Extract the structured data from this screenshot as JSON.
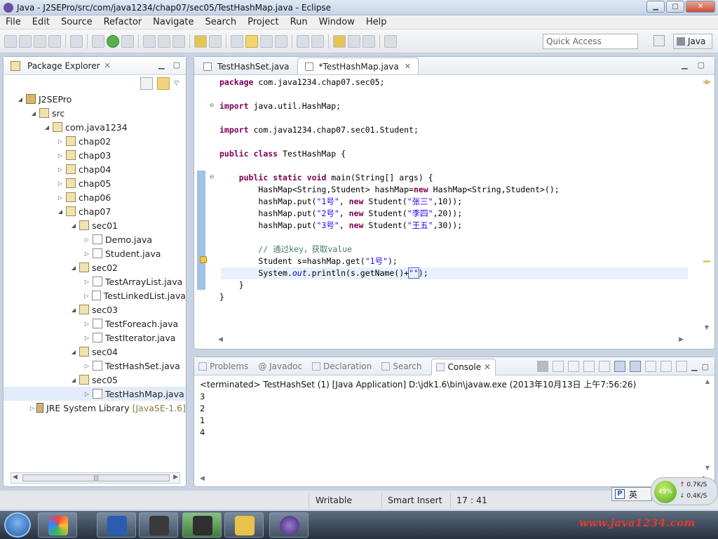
{
  "window": {
    "title": "Java - J2SEPro/src/com/java1234/chap07/sec05/TestHashMap.java - Eclipse",
    "min": "▁",
    "max": "▢",
    "close": "✕"
  },
  "menu": [
    "File",
    "Edit",
    "Source",
    "Refactor",
    "Navigate",
    "Search",
    "Project",
    "Run",
    "Window",
    "Help"
  ],
  "toolbar": {
    "quick_access_placeholder": "Quick Access",
    "perspective": "Java"
  },
  "package_explorer": {
    "title": "Package Explorer",
    "tree": [
      {
        "label": "J2SEPro",
        "indent": 0,
        "icon": "project",
        "twisty": "◢"
      },
      {
        "label": "src",
        "indent": 1,
        "icon": "package",
        "twisty": "◢"
      },
      {
        "label": "com.java1234",
        "indent": 2,
        "icon": "package",
        "twisty": "◢"
      },
      {
        "label": "chap02",
        "indent": 3,
        "icon": "package",
        "twisty": "▷"
      },
      {
        "label": "chap03",
        "indent": 3,
        "icon": "package",
        "twisty": "▷"
      },
      {
        "label": "chap04",
        "indent": 3,
        "icon": "package",
        "twisty": "▷"
      },
      {
        "label": "chap05",
        "indent": 3,
        "icon": "package",
        "twisty": "▷"
      },
      {
        "label": "chap06",
        "indent": 3,
        "icon": "package",
        "twisty": "▷"
      },
      {
        "label": "chap07",
        "indent": 3,
        "icon": "package",
        "twisty": "◢"
      },
      {
        "label": "sec01",
        "indent": 4,
        "icon": "package",
        "twisty": "◢"
      },
      {
        "label": "Demo.java",
        "indent": 5,
        "icon": "java",
        "twisty": "▷"
      },
      {
        "label": "Student.java",
        "indent": 5,
        "icon": "java",
        "twisty": "▷"
      },
      {
        "label": "sec02",
        "indent": 4,
        "icon": "package",
        "twisty": "◢"
      },
      {
        "label": "TestArrayList.java",
        "indent": 5,
        "icon": "java",
        "twisty": "▷"
      },
      {
        "label": "TestLinkedList.java",
        "indent": 5,
        "icon": "java",
        "twisty": "▷"
      },
      {
        "label": "sec03",
        "indent": 4,
        "icon": "package",
        "twisty": "◢"
      },
      {
        "label": "TestForeach.java",
        "indent": 5,
        "icon": "java",
        "twisty": "▷"
      },
      {
        "label": "TestIterator.java",
        "indent": 5,
        "icon": "java",
        "twisty": "▷"
      },
      {
        "label": "sec04",
        "indent": 4,
        "icon": "package",
        "twisty": "◢"
      },
      {
        "label": "TestHashSet.java",
        "indent": 5,
        "icon": "java",
        "twisty": "▷"
      },
      {
        "label": "sec05",
        "indent": 4,
        "icon": "package",
        "twisty": "◢"
      },
      {
        "label": "TestHashMap.java",
        "indent": 5,
        "icon": "java",
        "twisty": "▷",
        "selected": true
      },
      {
        "label": "JRE System Library",
        "extra": "[JavaSE-1.6]",
        "indent": 1,
        "icon": "jre",
        "twisty": "▷"
      }
    ]
  },
  "editor": {
    "tabs": [
      {
        "label": "TestHashSet.java",
        "active": false
      },
      {
        "label": "*TestHashMap.java",
        "active": true
      }
    ],
    "code": {
      "l1": "com.java1234.chap07.sec05;",
      "l2": "java.util.HashMap;",
      "l3": "com.java1234.chap07.sec01.Student;",
      "l4": "TestHashMap {",
      "l5a": "main(String[] args) {",
      "l6": "HashMap<String,Student> hashMap=",
      "l6b": "HashMap<String,Student>();",
      "put1k": "\"1号\"",
      "put1v": "\"张三\"",
      "put1n": ",10));",
      "put2k": "\"2号\"",
      "put2v": "\"李四\"",
      "put2n": ",20));",
      "put3k": "\"3号\"",
      "put3v": "\"王五\"",
      "put3n": ",30));",
      "comment": "// 通过key，获取value",
      "l11a": "Student s=hashMap.get(",
      "l11k": "\"1号\"",
      "l11b": ");",
      "l12a": "System.",
      "l12out": "out",
      "l12b": ".println(s.getName()+",
      "l12s": "\"\"",
      "l12c": ");",
      "close1": "}",
      "close2": "}"
    }
  },
  "console": {
    "tabs": [
      "Problems",
      "Javadoc",
      "Declaration",
      "Search",
      "Console"
    ],
    "terminated": "<terminated> TestHashSet (1) [Java Application] D:\\jdk1.6\\bin\\javaw.exe (2013年10月13日 上午7:56:26)",
    "output": [
      "3",
      "2",
      "1",
      "4"
    ]
  },
  "status": {
    "writable": "Writable",
    "insert": "Smart Insert",
    "position": "17 : 41"
  },
  "ime": {
    "logo": "P",
    "lang": "英"
  },
  "net": {
    "percent": "49%",
    "up": "0.7K/S",
    "down": "0.4K/S"
  },
  "watermark": "www.java1234.com",
  "colors": {
    "keyword": "#7f0055",
    "string": "#2a00ff",
    "comment": "#3f7f5f"
  }
}
